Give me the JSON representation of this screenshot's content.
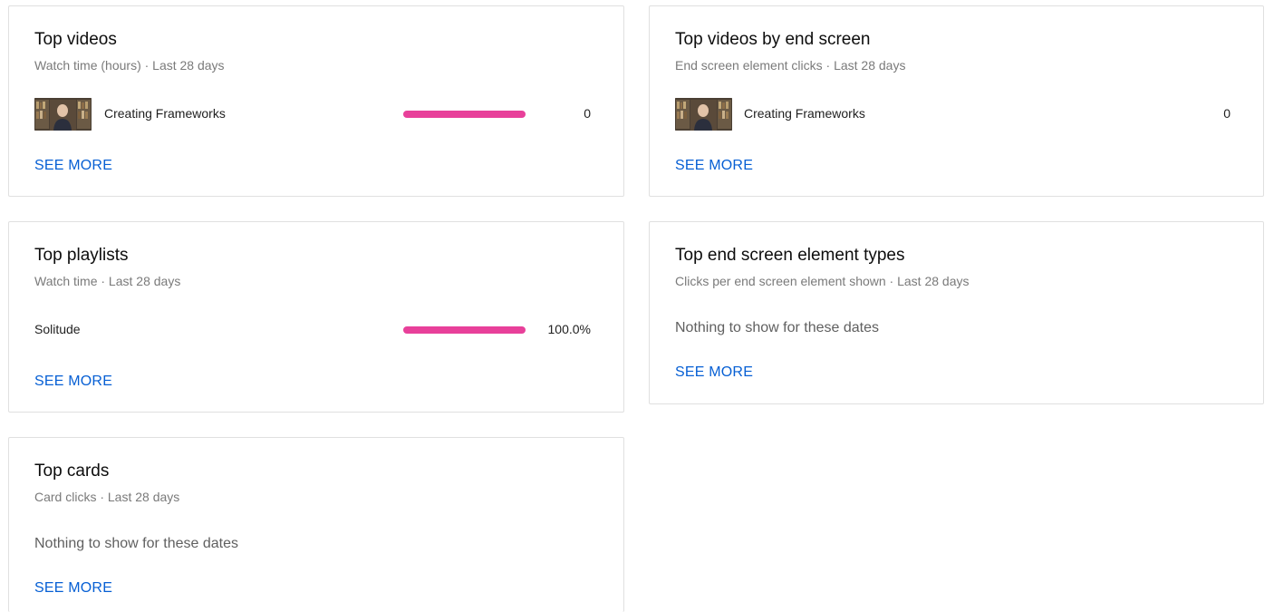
{
  "cards": {
    "top_videos": {
      "title": "Top videos",
      "subtitle": "Watch time (hours) · Last 28 days",
      "rows": [
        {
          "label": "Creating Frameworks",
          "value": "0",
          "bar_fraction": 1.0
        }
      ],
      "see_more": "SEE MORE"
    },
    "top_videos_end_screen": {
      "title": "Top videos by end screen",
      "subtitle": "End screen element clicks · Last 28 days",
      "rows": [
        {
          "label": "Creating Frameworks",
          "value": "0"
        }
      ],
      "see_more": "SEE MORE"
    },
    "top_playlists": {
      "title": "Top playlists",
      "subtitle": "Watch time · Last 28 days",
      "rows": [
        {
          "label": "Solitude",
          "value": "100.0%",
          "bar_fraction": 1.0
        }
      ],
      "see_more": "SEE MORE"
    },
    "top_end_screen_types": {
      "title": "Top end screen element types",
      "subtitle": "Clicks per end screen element shown · Last 28 days",
      "empty_message": "Nothing to show for these dates",
      "see_more": "SEE MORE"
    },
    "top_cards": {
      "title": "Top cards",
      "subtitle": "Card clicks · Last 28 days",
      "empty_message": "Nothing to show for these dates",
      "see_more": "SEE MORE"
    }
  },
  "colors": {
    "bar": "#e8409a",
    "link": "#065fd4",
    "subtitle": "#7a7a7a"
  }
}
